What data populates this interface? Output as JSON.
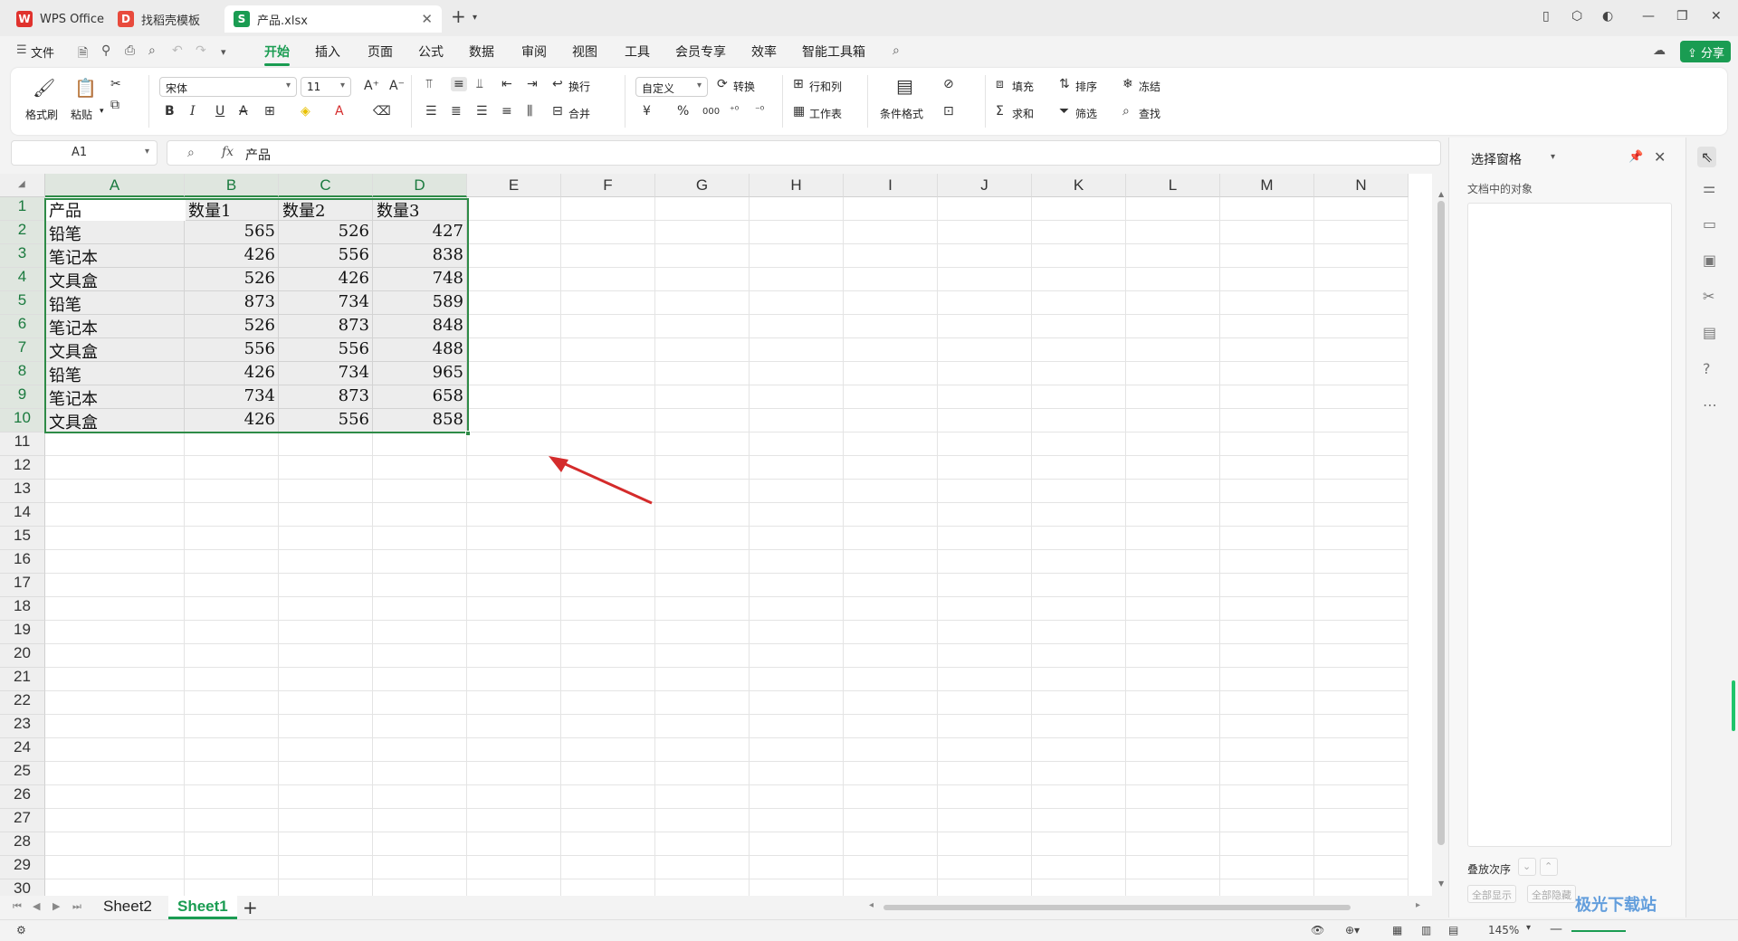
{
  "tabs": [
    {
      "label": "WPS Office",
      "icon": "wps-logo-icon"
    },
    {
      "label": "找稻壳模板",
      "icon": "docer-icon"
    },
    {
      "label": "产品.xlsx",
      "icon": "spreadsheet-icon",
      "active": true
    }
  ],
  "menu": {
    "file": "文件",
    "items": [
      "开始",
      "插入",
      "页面",
      "公式",
      "数据",
      "审阅",
      "视图",
      "工具",
      "会员专享",
      "效率",
      "智能工具箱"
    ],
    "active": "开始",
    "share": "分享"
  },
  "ribbon": {
    "format_painter": "格式刷",
    "paste": "粘贴",
    "font_name": "宋体",
    "font_size": "11",
    "wrap": "换行",
    "merge": "合并",
    "number_format": "自定义",
    "convert": "转换",
    "rows_cols": "行和列",
    "worksheet": "工作表",
    "cond_format": "条件格式",
    "fill": "填充",
    "sort": "排序",
    "freeze": "冻结",
    "sum": "求和",
    "filter": "筛选",
    "find": "查找",
    "bold": "B",
    "italic": "I",
    "underline": "U",
    "strike": "A",
    "currency": "¥",
    "percent": "%",
    "thousands": "000"
  },
  "formula_bar": {
    "cell_ref": "A1",
    "fx": "fx",
    "value": "产品"
  },
  "grid": {
    "columns": [
      "A",
      "B",
      "C",
      "D",
      "E",
      "F",
      "G",
      "H",
      "I",
      "J",
      "K",
      "L",
      "M",
      "N"
    ],
    "rows": [
      "1",
      "2",
      "3",
      "4",
      "5",
      "6",
      "7",
      "8",
      "9",
      "10",
      "11",
      "12",
      "13",
      "14",
      "15",
      "16",
      "17",
      "18",
      "19",
      "20",
      "21",
      "22",
      "23",
      "24",
      "25",
      "26",
      "27",
      "28",
      "29",
      "30"
    ],
    "header": [
      "产品",
      "数量1",
      "数量2",
      "数量3"
    ],
    "data": [
      [
        "铅笔",
        "565",
        "526",
        "427"
      ],
      [
        "笔记本",
        "426",
        "556",
        "838"
      ],
      [
        "文具盒",
        "526",
        "426",
        "748"
      ],
      [
        "铅笔",
        "873",
        "734",
        "589"
      ],
      [
        "笔记本",
        "526",
        "873",
        "848"
      ],
      [
        "文具盒",
        "556",
        "556",
        "488"
      ],
      [
        "铅笔",
        "426",
        "734",
        "965"
      ],
      [
        "笔记本",
        "734",
        "873",
        "658"
      ],
      [
        "文具盒",
        "426",
        "556",
        "858"
      ]
    ]
  },
  "sheets": {
    "list": [
      "Sheet2",
      "Sheet1"
    ],
    "active": "Sheet1",
    "add": "+"
  },
  "right_pane": {
    "title": "选择窗格",
    "subtitle": "文档中的对象",
    "order_label": "叠放次序",
    "show_all": "全部显示",
    "hide_all": "全部隐藏"
  },
  "status": {
    "zoom": "145%"
  },
  "watermark": "极光下载站",
  "colors": {
    "accent": "#1a9c52",
    "selection_border": "#2e8b47",
    "arrow": "#d42b2b"
  }
}
